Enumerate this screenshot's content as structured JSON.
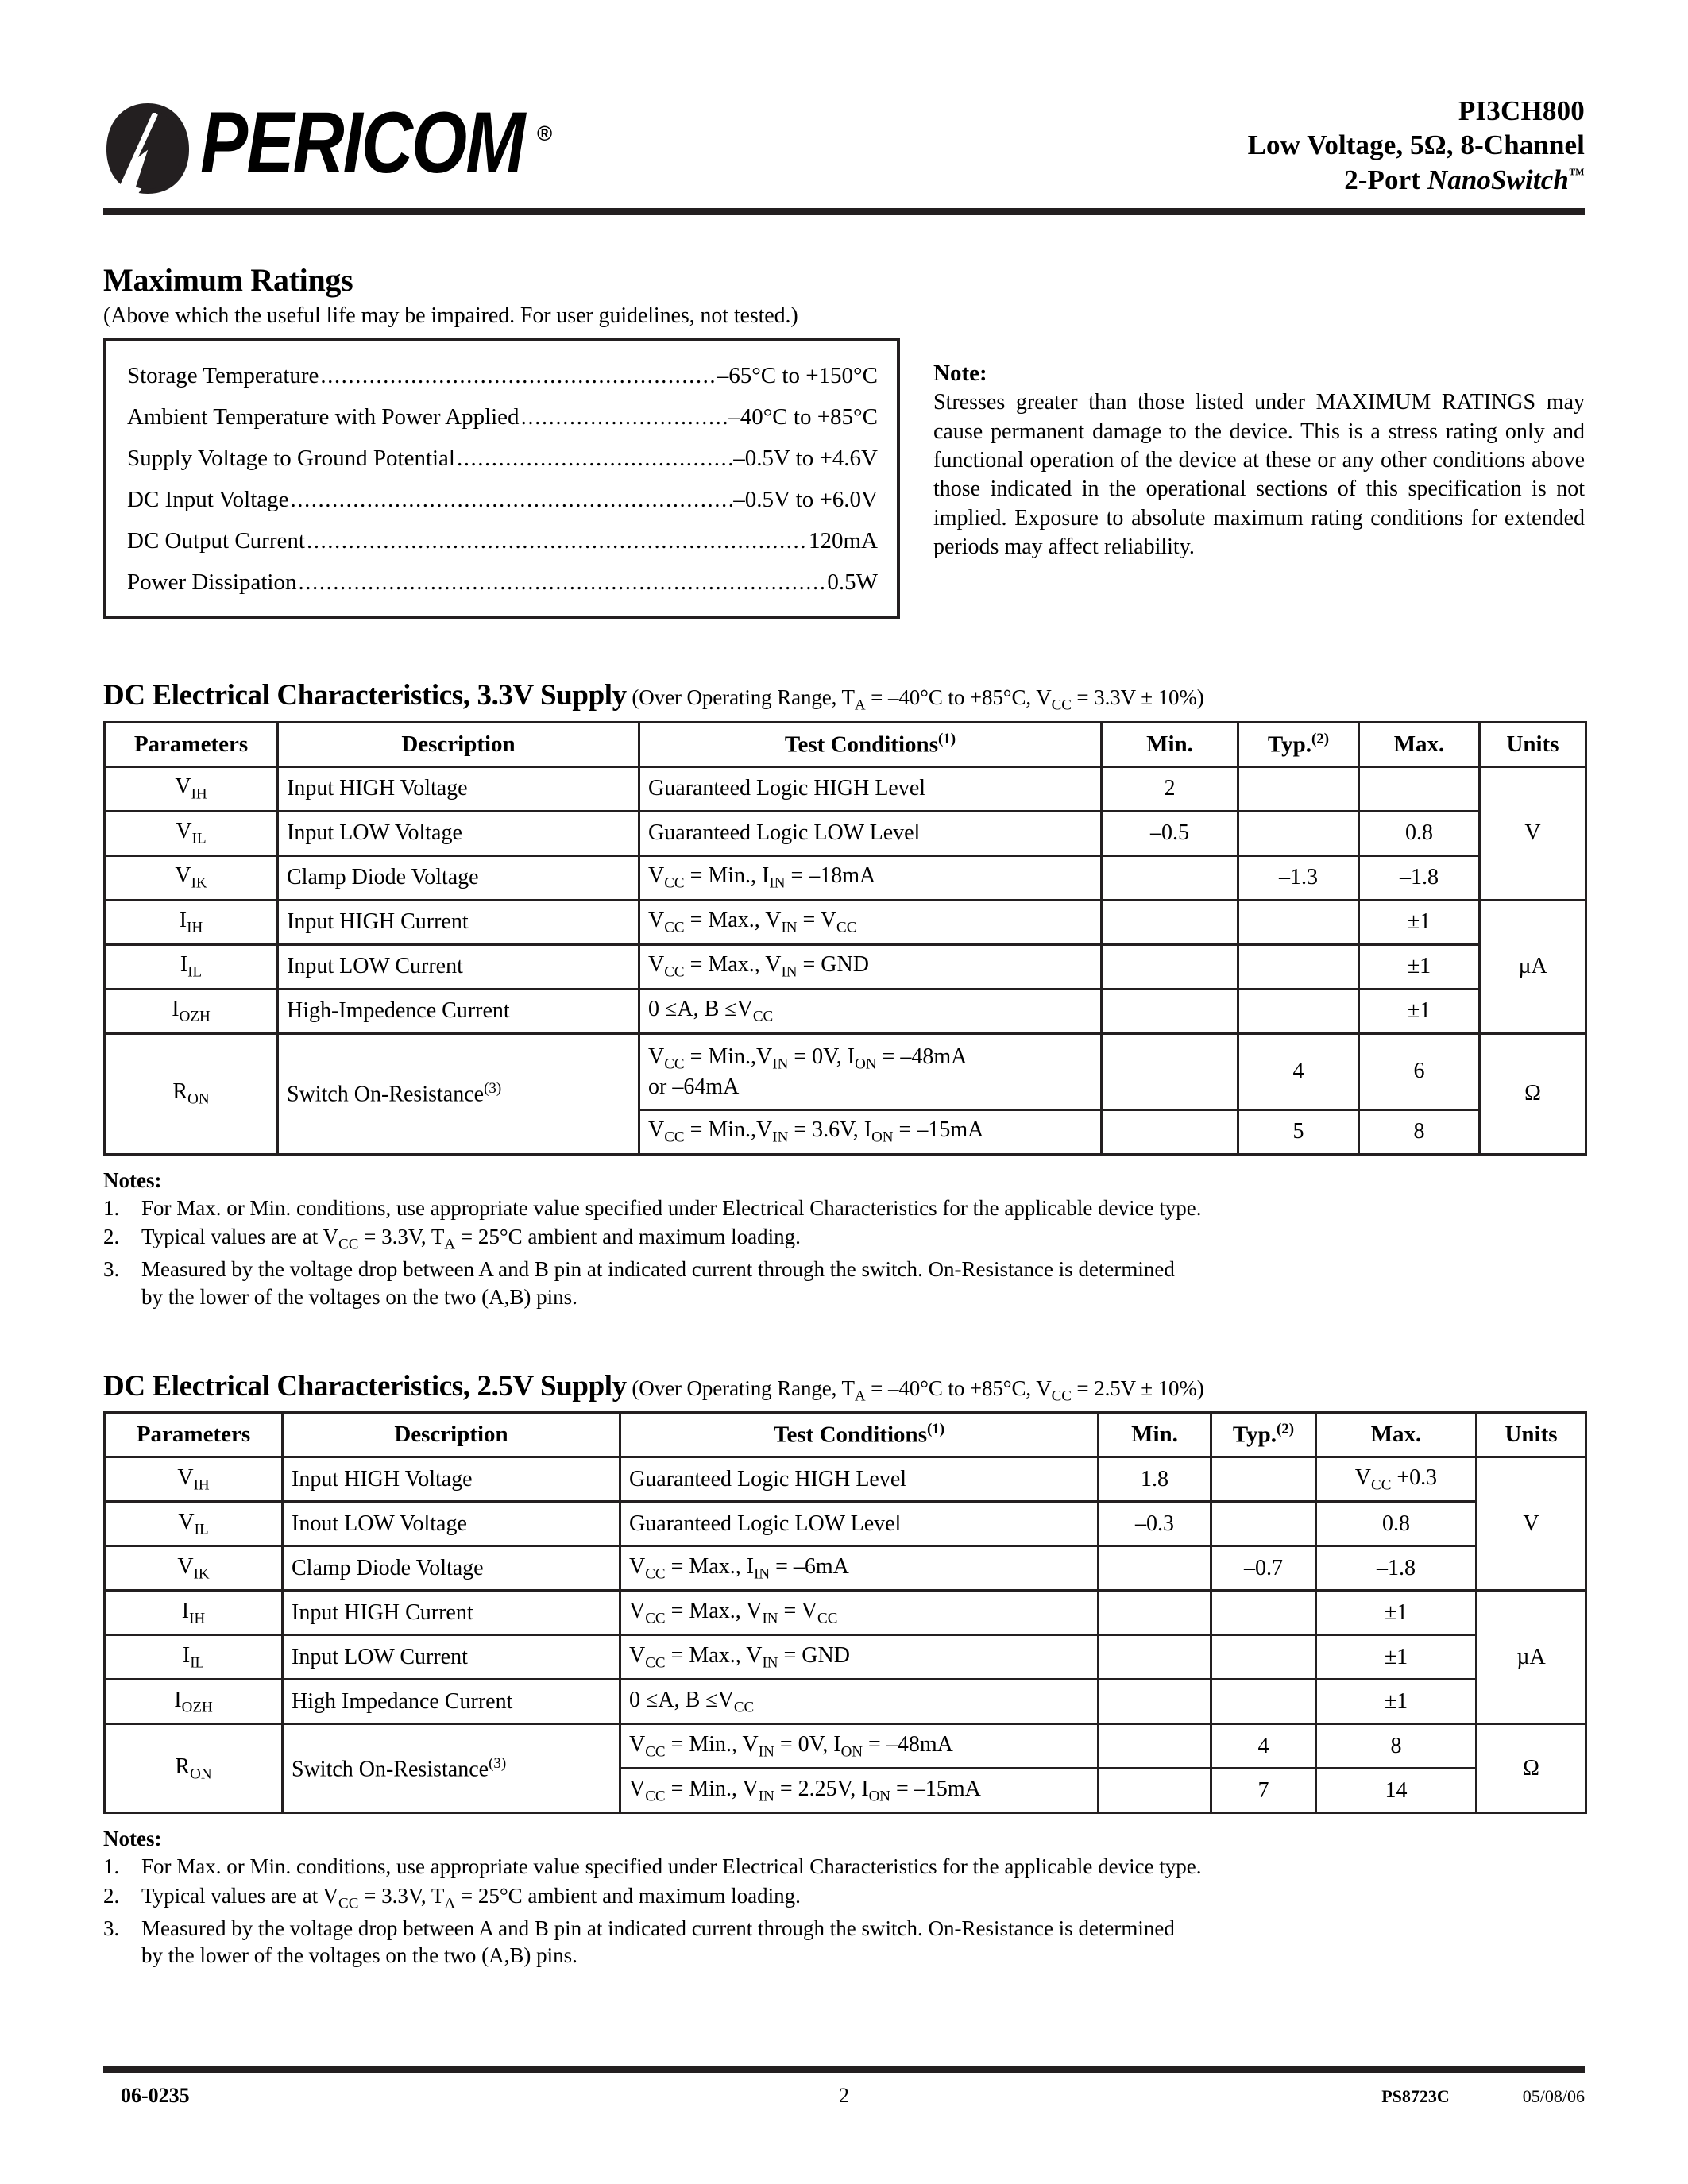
{
  "header": {
    "logo_text": "PERICOM",
    "logo_registered": "®",
    "part_number": "PI3CH800",
    "title_line2": "Low Voltage, 5Ω, 8-Channel",
    "title_line3_a": "2-Port ",
    "title_line3_b": "NanoSwitch",
    "title_line3_tm": "™"
  },
  "max_ratings": {
    "section_title": "Maximum Ratings",
    "subtitle": "(Above which the useful life may be impaired. For user guidelines, not tested.)",
    "rows": [
      {
        "label": "Storage Temperature",
        "value": "–65°C to +150°C"
      },
      {
        "label": "Ambient Temperature with Power Applied",
        "value": "–40°C to +85°C"
      },
      {
        "label": "Supply Voltage to Ground Potential",
        "value": "–0.5V to +4.6V"
      },
      {
        "label": "DC Input Voltage",
        "value": "–0.5V to +6.0V"
      },
      {
        "label": "DC Output Current",
        "value": "120mA"
      },
      {
        "label": "Power Dissipation",
        "value": "0.5W"
      }
    ],
    "note_title": "Note:",
    "note_text": "Stresses greater than those listed under MAXIMUM RATINGS may cause permanent damage to the device. This is a stress rating only and functional operation of the device at these or any other conditions above those indicated in the operational sections of this specification is not implied.  Exposure to absolute maximum rating conditions for extended periods may affect reliability."
  },
  "table_33v": {
    "heading_bold": "DC Electrical Characteristics, 3.3V Supply",
    "heading_rest_a": " (Over  Operating Range, T",
    "heading_rest_sub_a": "A",
    "heading_rest_b": " = –40°C to +85°C, V",
    "heading_rest_sub_b": "CC",
    "heading_rest_c": " = 3.3V ± 10%)",
    "columns": [
      "Parameters",
      "Description",
      "Test Conditions",
      "Min.",
      "Typ.",
      "Max.",
      "Units"
    ],
    "col_sup": {
      "test_conditions": "(1)",
      "typ": "(2)"
    },
    "rows": [
      {
        "param": "V",
        "param_sub": "IH",
        "description": "Input HIGH Voltage",
        "test": "Guaranteed Logic HIGH Level",
        "min": "2",
        "typ": "",
        "max": "",
        "units": ""
      },
      {
        "param": "V",
        "param_sub": "IL",
        "description": "Input LOW Voltage",
        "test": "Guaranteed Logic LOW Level",
        "min": "–0.5",
        "typ": "",
        "max": "0.8",
        "units": "V"
      },
      {
        "param": "V",
        "param_sub": "IK",
        "description": "Clamp Diode Voltage",
        "test": "VCC = Min., IIN = –18mA",
        "min": "",
        "typ": "–1.3",
        "max": "–1.8",
        "units": ""
      },
      {
        "param": "I",
        "param_sub": "IH",
        "description": "Input HIGH Current",
        "test": "VCC = Max., VIN = VCC",
        "min": "",
        "typ": "",
        "max": "±1",
        "units": ""
      },
      {
        "param": "I",
        "param_sub": "IL",
        "description": "Input LOW Current",
        "test": "VCC = Max., VIN = GND",
        "min": "",
        "typ": "",
        "max": "±1",
        "units": "µA"
      },
      {
        "param": "I",
        "param_sub": "OZH",
        "description": "High-Impedence Current",
        "test": "0 ≤A, B ≤VCC",
        "min": "",
        "typ": "",
        "max": "±1",
        "units": ""
      }
    ],
    "ron": {
      "param": "R",
      "param_sub": "ON",
      "description": "Switch On-Resistance",
      "description_sup": "(3)",
      "units": "Ω",
      "subrows": [
        {
          "test_line1": "VCC = Min.,VIN = 0V, ION = –48mA",
          "test_line2": "or –64mA",
          "min": "",
          "typ": "4",
          "max": "6"
        },
        {
          "test_line1": "VCC = Min.,VIN = 3.6V, ION = –15mA",
          "test_line2": "",
          "min": "",
          "typ": "5",
          "max": "8"
        }
      ]
    }
  },
  "table_25v": {
    "heading_bold": "DC Electrical Characteristics, 2.5V Supply",
    "heading_rest_a": " (Over  Operating Range, T",
    "heading_rest_sub_a": "A",
    "heading_rest_b": " = –40°C to +85°C, V",
    "heading_rest_sub_b": "CC",
    "heading_rest_c": " = 2.5V ± 10%)",
    "columns": [
      "Parameters",
      "Description",
      "Test Conditions",
      "Min.",
      "Typ.",
      "Max.",
      "Units"
    ],
    "col_sup": {
      "test_conditions": "(1)",
      "typ": "(2)"
    },
    "rows": [
      {
        "param": "V",
        "param_sub": "IH",
        "description": "Input HIGH Voltage",
        "test": "Guaranteed Logic HIGH Level",
        "min": "1.8",
        "typ": "",
        "max": "VCC +0.3",
        "units": ""
      },
      {
        "param": "V",
        "param_sub": "IL",
        "description": "Inout LOW Voltage",
        "test": "Guaranteed Logic LOW Level",
        "min": "–0.3",
        "typ": "",
        "max": "0.8",
        "units": "V"
      },
      {
        "param": "V",
        "param_sub": "IK",
        "description": "Clamp Diode Voltage",
        "test": "VCC = Max., IIN = –6mA",
        "min": "",
        "typ": "–0.7",
        "max": "–1.8",
        "units": ""
      },
      {
        "param": "I",
        "param_sub": "IH",
        "description": "Input HIGH Current",
        "test": "VCC = Max., VIN = VCC",
        "min": "",
        "typ": "",
        "max": "±1",
        "units": ""
      },
      {
        "param": "I",
        "param_sub": "IL",
        "description": "Input LOW Current",
        "test": "VCC = Max., VIN = GND",
        "min": "",
        "typ": "",
        "max": "±1",
        "units": "µA"
      },
      {
        "param": "I",
        "param_sub": "OZH",
        "description": "High Impedance Current",
        "test": "0 ≤A, B  ≤VCC",
        "min": "",
        "typ": "",
        "max": "±1",
        "units": ""
      }
    ],
    "ron": {
      "param": "R",
      "param_sub": "ON",
      "description": "Switch On-Resistance",
      "description_sup": "(3)",
      "units": "Ω",
      "subrows": [
        {
          "test_line1": "VCC = Min., VIN = 0V, ION = –48mA",
          "test_line2": "",
          "min": "",
          "typ": "4",
          "max": "8"
        },
        {
          "test_line1": "VCC = Min., VIN = 2.25V, ION = –15mA",
          "test_line2": "",
          "min": "",
          "typ": "7",
          "max": "14"
        }
      ]
    }
  },
  "notes": {
    "title": "Notes:",
    "items": [
      {
        "num": "1.",
        "text": "For Max. or Min. conditions, use appropriate value specified under Electrical Characteristics for the applicable device type."
      },
      {
        "num": "2.",
        "text": "Typical values are at VCC = 3.3V, TA = 25°C ambient and maximum loading."
      },
      {
        "num": "3.",
        "text": "Measured by the voltage drop between A and B pin at indicated current through the switch. On-Resistance is determined",
        "cont": "by the lower of the voltages on the two (A,B) pins."
      }
    ]
  },
  "footer": {
    "doc_code": "06-0235",
    "page_number": "2",
    "spec_code": "PS8723C",
    "date": "05/08/06"
  },
  "colors": {
    "ink": "#231f20",
    "paper": "#ffffff"
  }
}
